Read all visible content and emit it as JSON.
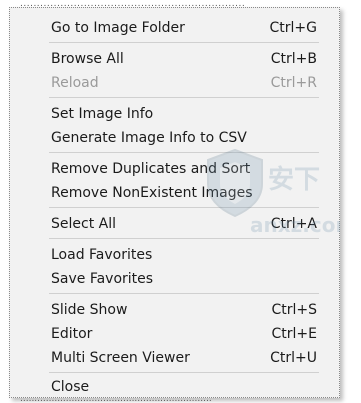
{
  "background": {
    "top_text": "...................................................................",
    "bottom_text": "..................................................................."
  },
  "menu": {
    "items": [
      {
        "label": "Go to Image Folder",
        "shortcut": "Ctrl+G",
        "enabled": true
      },
      {
        "label": "Browse All",
        "shortcut": "Ctrl+B",
        "enabled": true
      },
      {
        "label": "Reload",
        "shortcut": "Ctrl+R",
        "enabled": false
      },
      {
        "label": "Set Image Info",
        "shortcut": "",
        "enabled": true
      },
      {
        "label": "Generate Image Info to CSV",
        "shortcut": "",
        "enabled": true
      },
      {
        "label": "Remove Duplicates and Sort",
        "shortcut": "",
        "enabled": true
      },
      {
        "label": "Remove NonExistent Images",
        "shortcut": "",
        "enabled": true
      },
      {
        "label": "Select All",
        "shortcut": "Ctrl+A",
        "enabled": true
      },
      {
        "label": "Load Favorites",
        "shortcut": "",
        "enabled": true
      },
      {
        "label": "Save Favorites",
        "shortcut": "",
        "enabled": true
      },
      {
        "label": "Slide Show",
        "shortcut": "Ctrl+S",
        "enabled": true
      },
      {
        "label": "Editor",
        "shortcut": "Ctrl+E",
        "enabled": true
      },
      {
        "label": "Multi Screen Viewer",
        "shortcut": "Ctrl+U",
        "enabled": true
      },
      {
        "label": "Close",
        "shortcut": "",
        "enabled": true
      }
    ]
  },
  "watermark": {
    "text": "anxz.com",
    "icon": "shield-logo-icon"
  },
  "colors": {
    "menu_bg": "#f2f2f2",
    "text": "#1b1b1b",
    "disabled_text": "#9a9a9a",
    "separator": "#d0d0d0"
  }
}
